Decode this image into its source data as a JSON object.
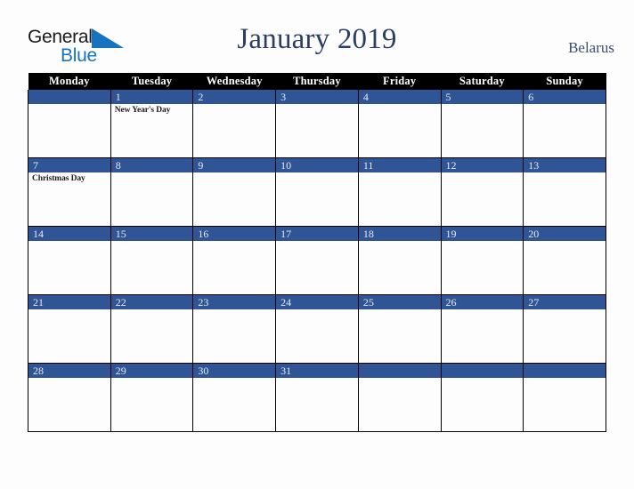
{
  "brand": {
    "name_part1": "General",
    "name_part2": "Blue",
    "triangle_icon": "triangle-icon",
    "blue_hex": "#1673c0",
    "dark_hex": "#1b1b1b"
  },
  "header": {
    "title": "January 2019",
    "country": "Belarus",
    "title_color": "#2b3f64"
  },
  "theme": {
    "header_row_bg": "#000000",
    "date_bar_bg": "#2f5596",
    "cell_bg": "#fdfdfd",
    "page_bg": "#fdfdfd",
    "border": "#000000"
  },
  "weekdays": [
    "Monday",
    "Tuesday",
    "Wednesday",
    "Thursday",
    "Friday",
    "Saturday",
    "Sunday"
  ],
  "weeks": [
    [
      {
        "date": "",
        "events": []
      },
      {
        "date": "1",
        "events": [
          "New Year's Day"
        ]
      },
      {
        "date": "2",
        "events": []
      },
      {
        "date": "3",
        "events": []
      },
      {
        "date": "4",
        "events": []
      },
      {
        "date": "5",
        "events": []
      },
      {
        "date": "6",
        "events": []
      }
    ],
    [
      {
        "date": "7",
        "events": [
          "Christmas Day"
        ]
      },
      {
        "date": "8",
        "events": []
      },
      {
        "date": "9",
        "events": []
      },
      {
        "date": "10",
        "events": []
      },
      {
        "date": "11",
        "events": []
      },
      {
        "date": "12",
        "events": []
      },
      {
        "date": "13",
        "events": []
      }
    ],
    [
      {
        "date": "14",
        "events": []
      },
      {
        "date": "15",
        "events": []
      },
      {
        "date": "16",
        "events": []
      },
      {
        "date": "17",
        "events": []
      },
      {
        "date": "18",
        "events": []
      },
      {
        "date": "19",
        "events": []
      },
      {
        "date": "20",
        "events": []
      }
    ],
    [
      {
        "date": "21",
        "events": []
      },
      {
        "date": "22",
        "events": []
      },
      {
        "date": "23",
        "events": []
      },
      {
        "date": "24",
        "events": []
      },
      {
        "date": "25",
        "events": []
      },
      {
        "date": "26",
        "events": []
      },
      {
        "date": "27",
        "events": []
      }
    ],
    [
      {
        "date": "28",
        "events": []
      },
      {
        "date": "29",
        "events": []
      },
      {
        "date": "30",
        "events": []
      },
      {
        "date": "31",
        "events": []
      },
      {
        "date": "",
        "events": []
      },
      {
        "date": "",
        "events": []
      },
      {
        "date": "",
        "events": []
      }
    ]
  ]
}
